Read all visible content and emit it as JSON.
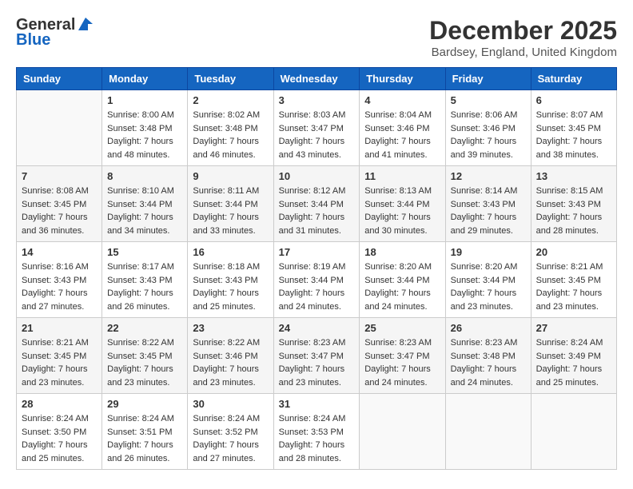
{
  "header": {
    "logo_line1": "General",
    "logo_line2": "Blue",
    "month_title": "December 2025",
    "location": "Bardsey, England, United Kingdom"
  },
  "weekdays": [
    "Sunday",
    "Monday",
    "Tuesday",
    "Wednesday",
    "Thursday",
    "Friday",
    "Saturday"
  ],
  "weeks": [
    [
      {
        "day": "",
        "sunrise": "",
        "sunset": "",
        "daylight": ""
      },
      {
        "day": "1",
        "sunrise": "8:00 AM",
        "sunset": "3:48 PM",
        "hours": "7",
        "minutes": "48"
      },
      {
        "day": "2",
        "sunrise": "8:02 AM",
        "sunset": "3:48 PM",
        "hours": "7",
        "minutes": "46"
      },
      {
        "day": "3",
        "sunrise": "8:03 AM",
        "sunset": "3:47 PM",
        "hours": "7",
        "minutes": "43"
      },
      {
        "day": "4",
        "sunrise": "8:04 AM",
        "sunset": "3:46 PM",
        "hours": "7",
        "minutes": "41"
      },
      {
        "day": "5",
        "sunrise": "8:06 AM",
        "sunset": "3:46 PM",
        "hours": "7",
        "minutes": "39"
      },
      {
        "day": "6",
        "sunrise": "8:07 AM",
        "sunset": "3:45 PM",
        "hours": "7",
        "minutes": "38"
      }
    ],
    [
      {
        "day": "7",
        "sunrise": "8:08 AM",
        "sunset": "3:45 PM",
        "hours": "7",
        "minutes": "36"
      },
      {
        "day": "8",
        "sunrise": "8:10 AM",
        "sunset": "3:44 PM",
        "hours": "7",
        "minutes": "34"
      },
      {
        "day": "9",
        "sunrise": "8:11 AM",
        "sunset": "3:44 PM",
        "hours": "7",
        "minutes": "33"
      },
      {
        "day": "10",
        "sunrise": "8:12 AM",
        "sunset": "3:44 PM",
        "hours": "7",
        "minutes": "31"
      },
      {
        "day": "11",
        "sunrise": "8:13 AM",
        "sunset": "3:44 PM",
        "hours": "7",
        "minutes": "30"
      },
      {
        "day": "12",
        "sunrise": "8:14 AM",
        "sunset": "3:43 PM",
        "hours": "7",
        "minutes": "29"
      },
      {
        "day": "13",
        "sunrise": "8:15 AM",
        "sunset": "3:43 PM",
        "hours": "7",
        "minutes": "28"
      }
    ],
    [
      {
        "day": "14",
        "sunrise": "8:16 AM",
        "sunset": "3:43 PM",
        "hours": "7",
        "minutes": "27"
      },
      {
        "day": "15",
        "sunrise": "8:17 AM",
        "sunset": "3:43 PM",
        "hours": "7",
        "minutes": "26"
      },
      {
        "day": "16",
        "sunrise": "8:18 AM",
        "sunset": "3:43 PM",
        "hours": "7",
        "minutes": "25"
      },
      {
        "day": "17",
        "sunrise": "8:19 AM",
        "sunset": "3:44 PM",
        "hours": "7",
        "minutes": "24"
      },
      {
        "day": "18",
        "sunrise": "8:20 AM",
        "sunset": "3:44 PM",
        "hours": "7",
        "minutes": "24"
      },
      {
        "day": "19",
        "sunrise": "8:20 AM",
        "sunset": "3:44 PM",
        "hours": "7",
        "minutes": "23"
      },
      {
        "day": "20",
        "sunrise": "8:21 AM",
        "sunset": "3:45 PM",
        "hours": "7",
        "minutes": "23"
      }
    ],
    [
      {
        "day": "21",
        "sunrise": "8:21 AM",
        "sunset": "3:45 PM",
        "hours": "7",
        "minutes": "23"
      },
      {
        "day": "22",
        "sunrise": "8:22 AM",
        "sunset": "3:45 PM",
        "hours": "7",
        "minutes": "23"
      },
      {
        "day": "23",
        "sunrise": "8:22 AM",
        "sunset": "3:46 PM",
        "hours": "7",
        "minutes": "23"
      },
      {
        "day": "24",
        "sunrise": "8:23 AM",
        "sunset": "3:47 PM",
        "hours": "7",
        "minutes": "23"
      },
      {
        "day": "25",
        "sunrise": "8:23 AM",
        "sunset": "3:47 PM",
        "hours": "7",
        "minutes": "24"
      },
      {
        "day": "26",
        "sunrise": "8:23 AM",
        "sunset": "3:48 PM",
        "hours": "7",
        "minutes": "24"
      },
      {
        "day": "27",
        "sunrise": "8:24 AM",
        "sunset": "3:49 PM",
        "hours": "7",
        "minutes": "25"
      }
    ],
    [
      {
        "day": "28",
        "sunrise": "8:24 AM",
        "sunset": "3:50 PM",
        "hours": "7",
        "minutes": "25"
      },
      {
        "day": "29",
        "sunrise": "8:24 AM",
        "sunset": "3:51 PM",
        "hours": "7",
        "minutes": "26"
      },
      {
        "day": "30",
        "sunrise": "8:24 AM",
        "sunset": "3:52 PM",
        "hours": "7",
        "minutes": "27"
      },
      {
        "day": "31",
        "sunrise": "8:24 AM",
        "sunset": "3:53 PM",
        "hours": "7",
        "minutes": "28"
      },
      {
        "day": "",
        "sunrise": "",
        "sunset": "",
        "hours": "",
        "minutes": ""
      },
      {
        "day": "",
        "sunrise": "",
        "sunset": "",
        "hours": "",
        "minutes": ""
      },
      {
        "day": "",
        "sunrise": "",
        "sunset": "",
        "hours": "",
        "minutes": ""
      }
    ]
  ],
  "labels": {
    "sunrise_prefix": "Sunrise: ",
    "sunset_prefix": "Sunset: ",
    "daylight_prefix": "Daylight: ",
    "hours_suffix": " hours",
    "and": "and ",
    "minutes_suffix": " minutes."
  }
}
